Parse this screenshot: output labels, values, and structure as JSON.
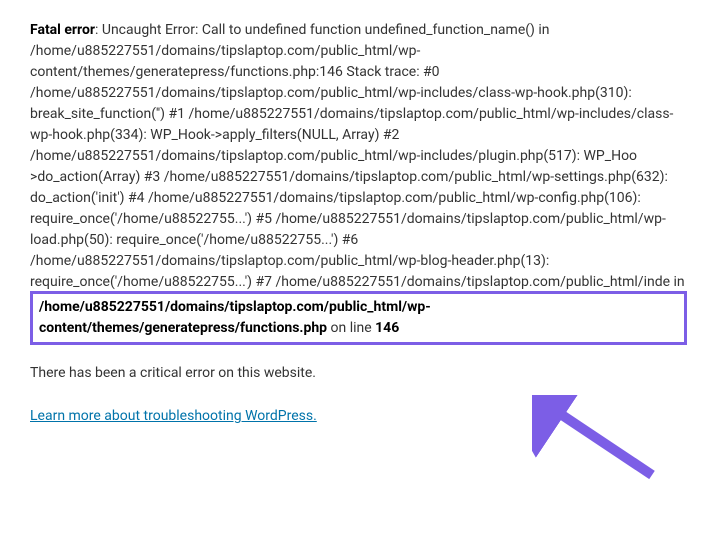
{
  "error": {
    "label": "Fatal error",
    "separator": ": ",
    "trace": "Uncaught Error: Call to undefined function undefined_function_name() in /home/u885227551/domains/tipslaptop.com/public_html/wp-content/themes/generatepress/functions.php:146 Stack trace: #0 /home/u885227551/domains/tipslaptop.com/public_html/wp-includes/class-wp-hook.php(310): break_site_function('') #1 /home/u885227551/domains/tipslaptop.com/public_html/wp-includes/class-wp-hook.php(334): WP_Hook->apply_filters(NULL, Array) #2 /home/u885227551/domains/tipslaptop.com/public_html/wp-includes/plugin.php(517): WP_Hoo >do_action(Array) #3 /home/u885227551/domains/tipslaptop.com/public_html/wp-settings.php(632): do_action('init') #4 /home/u885227551/domains/tipslaptop.com/public_html/wp-config.php(106): require_once('/home/u88522755...') #5 /home/u885227551/domains/tipslaptop.com/public_html/wp-load.php(50): require_once('/home/u88522755...') #6 /home/u885227551/domains/tipslaptop.com/public_html/wp-blog-header.php(13): require_once('/home/u88522755...') #7 /home/u885227551/domains/tipslaptop.com/public_html/inde in",
    "path": "/home/u885227551/domains/tipslaptop.com/public_html/wp-content/themes/generatepress/functions.php",
    "on_line_text": " on line ",
    "line_number": "146"
  },
  "critical_message": "There has been a critical error on this website.",
  "link_text": "Learn more about troubleshooting WordPress.",
  "annotation_colors": {
    "highlight": "#7c5ee6",
    "arrow": "#7c5ee6"
  }
}
